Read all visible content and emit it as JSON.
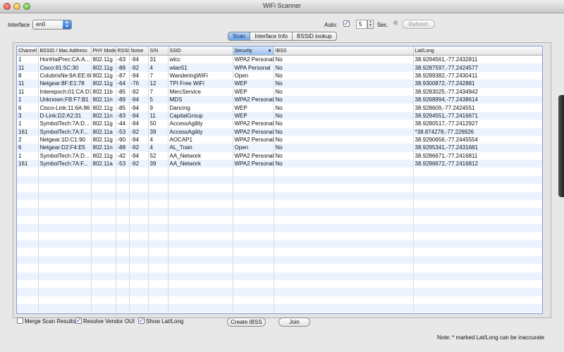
{
  "window": {
    "title": "WiFi Scanner"
  },
  "toolbar": {
    "interface_label": "Interface",
    "interface_value": "en0",
    "auto_label": "Auto:",
    "auto_checked": true,
    "interval_value": "5",
    "sec_label": "Sec.",
    "refresh_label": "Refresh"
  },
  "tabs": [
    {
      "label": "Scan",
      "active": true
    },
    {
      "label": "Interface Info",
      "active": false
    },
    {
      "label": "BSSID lookup",
      "active": false
    }
  ],
  "table": {
    "columns": [
      "Channel",
      "BSSID / Mac Address",
      "PHY Mode",
      "RSSI",
      "Noise",
      "S/N",
      "SSID",
      "Security",
      "IBSS",
      "Lat/Long"
    ],
    "sorted_column": "Security",
    "rows": [
      [
        "1",
        "HonHaiPrec:CA:A...",
        "802.11g",
        "-63",
        "-94",
        "31",
        "wlcc",
        "WPA2 Personal",
        "No",
        "38.9294561,-77.2432811"
      ],
      [
        "11",
        "Cisco:81:5C:30",
        "802.11g",
        "-88",
        "-92",
        "4",
        "wlan51",
        "WPA Personal",
        "No",
        "38.9287597,-77.2424577"
      ],
      [
        "8",
        "ColubrisNe:9A:EE:60",
        "802.11g",
        "-87",
        "-94",
        "7",
        "WanderingWiFi",
        "Open",
        "No",
        "38.9289382,-77.2430411"
      ],
      [
        "11",
        "Netgear:8F:E1:78",
        "802.11g",
        "-64",
        "-76",
        "12",
        "TPI Free WiFi",
        "WEP",
        "No",
        "38.9300872,-77.242881"
      ],
      [
        "11",
        "Interepoch:01:CA:D7",
        "802.11b",
        "-85",
        "-92",
        "7",
        "MercService",
        "WEP",
        "No",
        "38.9283025,-77.2434942"
      ],
      [
        "1",
        "Unknown:FB:F7:B1",
        "802.11n",
        "-89",
        "-94",
        "5",
        "MDS",
        "WPA2 Personal",
        "No",
        "38.9268994,-77.2438614"
      ],
      [
        "6",
        "Cisco-Link:11:6A:86",
        "802.11g",
        "-85",
        "-94",
        "9",
        "Dancing",
        "WEP",
        "No",
        "38.928609,-77.2424551"
      ],
      [
        "3",
        "D-Link:D2:A2:31",
        "802.11n",
        "-83",
        "-94",
        "11",
        "CapitalGroup",
        "WEP",
        "No",
        "38.9294551,-77.2416671"
      ],
      [
        "1",
        "SymbolTech:7A:D...",
        "802.11g",
        "-44",
        "-94",
        "50",
        "AccessAgility",
        "WPA2 Personal",
        "No",
        "38.9280517,-77.2412927"
      ],
      [
        "161",
        "SymbolTech:7A:F...",
        "802.11a",
        "-53",
        "-92",
        "39",
        "AccessAgility",
        "WPA2 Personal",
        "No",
        "*38.874278,-77.226926"
      ],
      [
        "2",
        "Netgear:1D:C1:90",
        "802.11g",
        "-90",
        "-94",
        "4",
        "AOCAP1",
        "WPA2 Personal",
        "No",
        "38.9290656,-77.2445554"
      ],
      [
        "6",
        "Netgear:D2:F4:E5",
        "802.11n",
        "-88",
        "-92",
        "4",
        "AL_Train",
        "Open",
        "No",
        "38.9295341,-77.2431681"
      ],
      [
        "1",
        "SymbolTech:7A:D...",
        "802.11g",
        "-42",
        "-94",
        "52",
        "AA_Network",
        "WPA2 Personal",
        "No",
        "38.9286671,-77.2416811"
      ],
      [
        "161",
        "SymbolTech:7A:F...",
        "802.11a",
        "-53",
        "-92",
        "39",
        "AA_Network",
        "WPA2 Personal",
        "No",
        "38.9286672,-77.2416812"
      ]
    ]
  },
  "footer": {
    "merge_label": "Merge Scan Results",
    "merge_checked": false,
    "resolve_label": "Resolve Vendor OUI",
    "resolve_checked": true,
    "latlong_label": "Show Lat/Long",
    "latlong_checked": true,
    "create_ibss_label": "Create IBSS",
    "join_label": "Join",
    "note": "Note: * marked Lat/Long can be inaccurate"
  }
}
